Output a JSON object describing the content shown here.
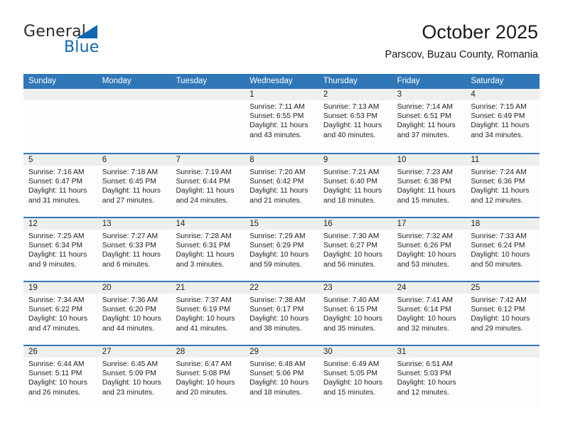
{
  "brand": {
    "name_top": "General",
    "name_bottom": "Blue",
    "accent_color": "#1267b2"
  },
  "header": {
    "title": "October 2025",
    "subtitle": "Parscov, Buzau County, Romania"
  },
  "theme": {
    "header_bar_color": "#3077b8",
    "day_number_bg": "#efefef",
    "cell_bg": "#fdfdfd"
  },
  "weekdays": [
    "Sunday",
    "Monday",
    "Tuesday",
    "Wednesday",
    "Thursday",
    "Friday",
    "Saturday"
  ],
  "labels": {
    "sunrise_prefix": "Sunrise:",
    "sunset_prefix": "Sunset:",
    "daylight_prefix": "Daylight:"
  },
  "weeks": [
    [
      {
        "empty": true
      },
      {
        "empty": true
      },
      {
        "empty": true
      },
      {
        "day": "1",
        "sunrise": "Sunrise: 7:11 AM",
        "sunset": "Sunset: 6:55 PM",
        "daylight": "Daylight: 11 hours and 43 minutes."
      },
      {
        "day": "2",
        "sunrise": "Sunrise: 7:13 AM",
        "sunset": "Sunset: 6:53 PM",
        "daylight": "Daylight: 11 hours and 40 minutes."
      },
      {
        "day": "3",
        "sunrise": "Sunrise: 7:14 AM",
        "sunset": "Sunset: 6:51 PM",
        "daylight": "Daylight: 11 hours and 37 minutes."
      },
      {
        "day": "4",
        "sunrise": "Sunrise: 7:15 AM",
        "sunset": "Sunset: 6:49 PM",
        "daylight": "Daylight: 11 hours and 34 minutes."
      }
    ],
    [
      {
        "day": "5",
        "sunrise": "Sunrise: 7:16 AM",
        "sunset": "Sunset: 6:47 PM",
        "daylight": "Daylight: 11 hours and 31 minutes."
      },
      {
        "day": "6",
        "sunrise": "Sunrise: 7:18 AM",
        "sunset": "Sunset: 6:45 PM",
        "daylight": "Daylight: 11 hours and 27 minutes."
      },
      {
        "day": "7",
        "sunrise": "Sunrise: 7:19 AM",
        "sunset": "Sunset: 6:44 PM",
        "daylight": "Daylight: 11 hours and 24 minutes."
      },
      {
        "day": "8",
        "sunrise": "Sunrise: 7:20 AM",
        "sunset": "Sunset: 6:42 PM",
        "daylight": "Daylight: 11 hours and 21 minutes."
      },
      {
        "day": "9",
        "sunrise": "Sunrise: 7:21 AM",
        "sunset": "Sunset: 6:40 PM",
        "daylight": "Daylight: 11 hours and 18 minutes."
      },
      {
        "day": "10",
        "sunrise": "Sunrise: 7:23 AM",
        "sunset": "Sunset: 6:38 PM",
        "daylight": "Daylight: 11 hours and 15 minutes."
      },
      {
        "day": "11",
        "sunrise": "Sunrise: 7:24 AM",
        "sunset": "Sunset: 6:36 PM",
        "daylight": "Daylight: 11 hours and 12 minutes."
      }
    ],
    [
      {
        "day": "12",
        "sunrise": "Sunrise: 7:25 AM",
        "sunset": "Sunset: 6:34 PM",
        "daylight": "Daylight: 11 hours and 9 minutes."
      },
      {
        "day": "13",
        "sunrise": "Sunrise: 7:27 AM",
        "sunset": "Sunset: 6:33 PM",
        "daylight": "Daylight: 11 hours and 6 minutes."
      },
      {
        "day": "14",
        "sunrise": "Sunrise: 7:28 AM",
        "sunset": "Sunset: 6:31 PM",
        "daylight": "Daylight: 11 hours and 3 minutes."
      },
      {
        "day": "15",
        "sunrise": "Sunrise: 7:29 AM",
        "sunset": "Sunset: 6:29 PM",
        "daylight": "Daylight: 10 hours and 59 minutes."
      },
      {
        "day": "16",
        "sunrise": "Sunrise: 7:30 AM",
        "sunset": "Sunset: 6:27 PM",
        "daylight": "Daylight: 10 hours and 56 minutes."
      },
      {
        "day": "17",
        "sunrise": "Sunrise: 7:32 AM",
        "sunset": "Sunset: 6:26 PM",
        "daylight": "Daylight: 10 hours and 53 minutes."
      },
      {
        "day": "18",
        "sunrise": "Sunrise: 7:33 AM",
        "sunset": "Sunset: 6:24 PM",
        "daylight": "Daylight: 10 hours and 50 minutes."
      }
    ],
    [
      {
        "day": "19",
        "sunrise": "Sunrise: 7:34 AM",
        "sunset": "Sunset: 6:22 PM",
        "daylight": "Daylight: 10 hours and 47 minutes."
      },
      {
        "day": "20",
        "sunrise": "Sunrise: 7:36 AM",
        "sunset": "Sunset: 6:20 PM",
        "daylight": "Daylight: 10 hours and 44 minutes."
      },
      {
        "day": "21",
        "sunrise": "Sunrise: 7:37 AM",
        "sunset": "Sunset: 6:19 PM",
        "daylight": "Daylight: 10 hours and 41 minutes."
      },
      {
        "day": "22",
        "sunrise": "Sunrise: 7:38 AM",
        "sunset": "Sunset: 6:17 PM",
        "daylight": "Daylight: 10 hours and 38 minutes."
      },
      {
        "day": "23",
        "sunrise": "Sunrise: 7:40 AM",
        "sunset": "Sunset: 6:15 PM",
        "daylight": "Daylight: 10 hours and 35 minutes."
      },
      {
        "day": "24",
        "sunrise": "Sunrise: 7:41 AM",
        "sunset": "Sunset: 6:14 PM",
        "daylight": "Daylight: 10 hours and 32 minutes."
      },
      {
        "day": "25",
        "sunrise": "Sunrise: 7:42 AM",
        "sunset": "Sunset: 6:12 PM",
        "daylight": "Daylight: 10 hours and 29 minutes."
      }
    ],
    [
      {
        "day": "26",
        "sunrise": "Sunrise: 6:44 AM",
        "sunset": "Sunset: 5:11 PM",
        "daylight": "Daylight: 10 hours and 26 minutes."
      },
      {
        "day": "27",
        "sunrise": "Sunrise: 6:45 AM",
        "sunset": "Sunset: 5:09 PM",
        "daylight": "Daylight: 10 hours and 23 minutes."
      },
      {
        "day": "28",
        "sunrise": "Sunrise: 6:47 AM",
        "sunset": "Sunset: 5:08 PM",
        "daylight": "Daylight: 10 hours and 20 minutes."
      },
      {
        "day": "29",
        "sunrise": "Sunrise: 6:48 AM",
        "sunset": "Sunset: 5:06 PM",
        "daylight": "Daylight: 10 hours and 18 minutes."
      },
      {
        "day": "30",
        "sunrise": "Sunrise: 6:49 AM",
        "sunset": "Sunset: 5:05 PM",
        "daylight": "Daylight: 10 hours and 15 minutes."
      },
      {
        "day": "31",
        "sunrise": "Sunrise: 6:51 AM",
        "sunset": "Sunset: 5:03 PM",
        "daylight": "Daylight: 10 hours and 12 minutes."
      },
      {
        "empty": true
      }
    ]
  ]
}
